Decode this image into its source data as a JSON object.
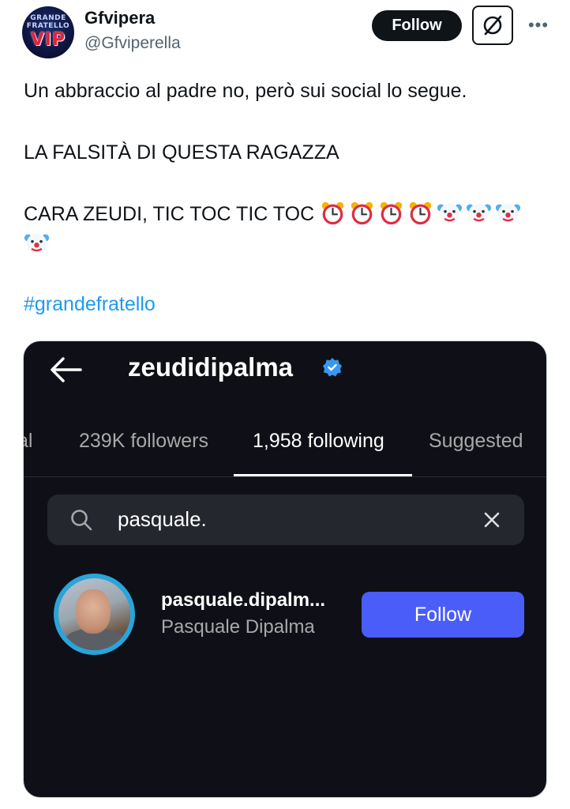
{
  "tweet": {
    "author": {
      "display_name": "Gfvipera",
      "handle": "@Gfviperella",
      "avatar_text_top": "GRANDE FRATELLO",
      "avatar_text_bottom": "VIP"
    },
    "follow_label": "Follow",
    "more_label": "•••",
    "text_lines": [
      "Un abbraccio al padre no, però sui social lo segue.",
      "LA FALSITÀ DI QUESTA RAGAZZA",
      "CARA ZEUDI, TIC TOC TIC TOC"
    ],
    "emojis": [
      "alarm-clock",
      "alarm-clock",
      "alarm-clock",
      "alarm-clock",
      "clown-face",
      "clown-face",
      "clown-face",
      "clown-face"
    ],
    "hashtag": "#grandefratello"
  },
  "embedded_screenshot": {
    "profile_name": "zeudidipalma",
    "tabs": [
      {
        "label": "al",
        "active": false
      },
      {
        "label": "239K followers",
        "active": false
      },
      {
        "label": "1,958 following",
        "active": true
      },
      {
        "label": "Suggested",
        "active": false
      }
    ],
    "search_value": "pasquale.",
    "result": {
      "username": "pasquale.dipalm...",
      "full_name": "Pasquale Dipalma",
      "follow_label": "Follow"
    }
  },
  "colors": {
    "link": "#1d9bf0",
    "ig_background": "#0f1017",
    "ig_follow": "#4a5df9",
    "verified": "#3897f0"
  }
}
